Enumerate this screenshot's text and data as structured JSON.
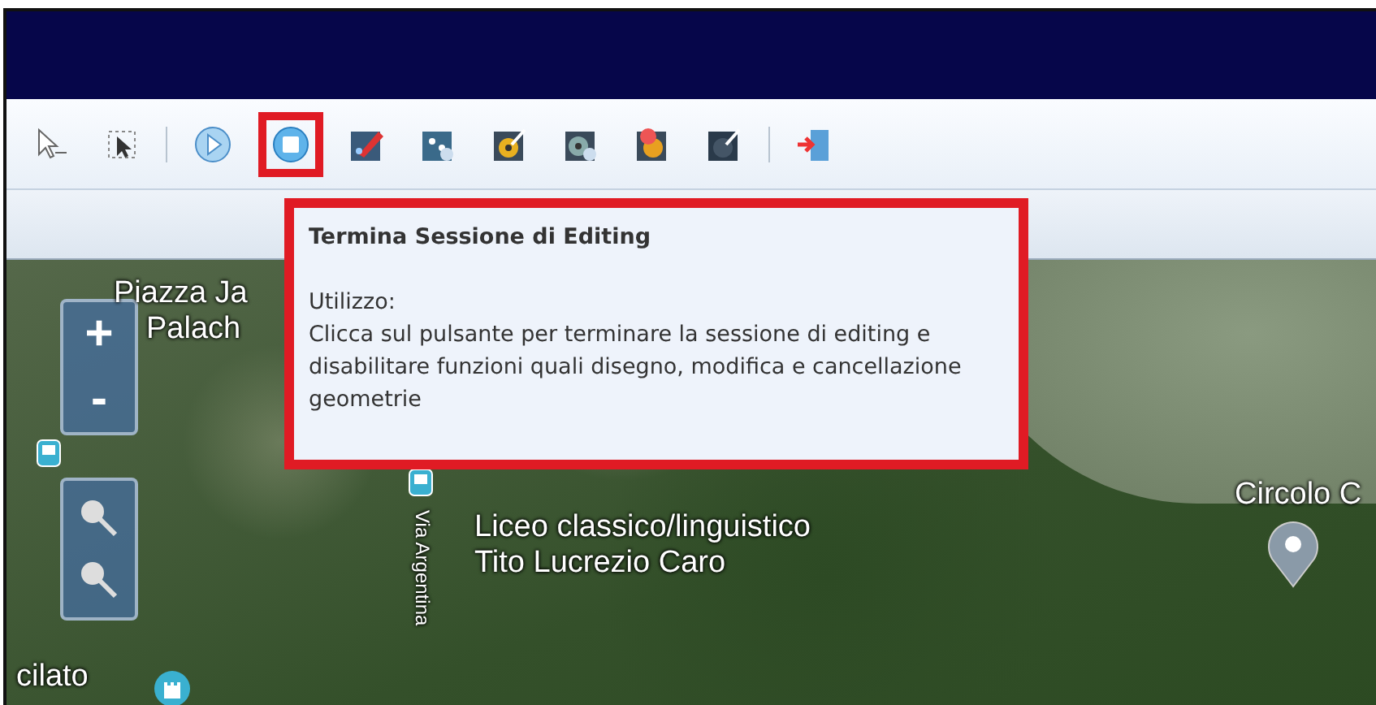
{
  "toolbar": {
    "buttons": [
      {
        "kind": "pointer",
        "highlighted": false
      },
      {
        "kind": "select",
        "highlighted": false
      },
      {
        "kind": "separator"
      },
      {
        "kind": "start",
        "highlighted": false
      },
      {
        "kind": "stop",
        "highlighted": true
      },
      {
        "kind": "draw",
        "highlighted": false
      },
      {
        "kind": "move",
        "highlighted": false
      },
      {
        "kind": "edit-point",
        "highlighted": false
      },
      {
        "kind": "edit-vertex",
        "highlighted": false
      },
      {
        "kind": "delete",
        "highlighted": false
      },
      {
        "kind": "modify",
        "highlighted": false
      },
      {
        "kind": "separator"
      },
      {
        "kind": "exit",
        "highlighted": false
      }
    ]
  },
  "tooltip": {
    "highlighted": true,
    "title": "Termina Sessione di Editing",
    "heading": "Utilizzo:",
    "body": "Clicca sul pulsante per terminare la sessione di editing e disabilitare funzioni quali disegno, modifica e cancellazione geometrie"
  },
  "map": {
    "zoom_in": "+",
    "zoom_out": "-",
    "labels": [
      {
        "kind": "place",
        "text": "Piazza Ja"
      },
      {
        "kind": "place",
        "text": "Palach"
      },
      {
        "kind": "street",
        "text": "Via Argentina"
      },
      {
        "kind": "place",
        "text": "Liceo classico/linguistico"
      },
      {
        "kind": "place",
        "text": "Tito Lucrezio Caro"
      },
      {
        "kind": "place",
        "text": "Circolo C"
      },
      {
        "kind": "place",
        "text": "cilato"
      }
    ]
  }
}
